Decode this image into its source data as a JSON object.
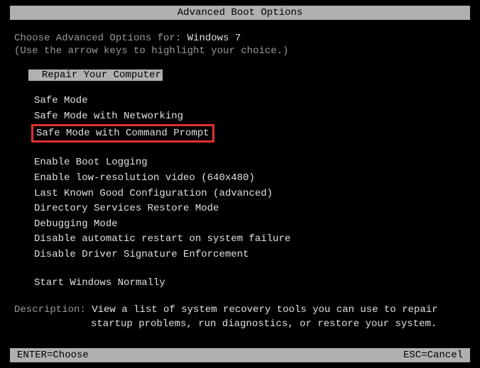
{
  "title": "Advanced Boot Options",
  "prompt": {
    "prefix": "Choose Advanced Options for: ",
    "os": "Windows 7"
  },
  "hint": "(Use the arrow keys to highlight your choice.)",
  "selected_option": "Repair Your Computer",
  "menu_group1": [
    "Safe Mode",
    "Safe Mode with Networking"
  ],
  "highlighted_item": "Safe Mode with Command Prompt",
  "menu_group2": [
    "Enable Boot Logging",
    "Enable low-resolution video (640x480)",
    "Last Known Good Configuration (advanced)",
    "Directory Services Restore Mode",
    "Debugging Mode",
    "Disable automatic restart on system failure",
    "Disable Driver Signature Enforcement"
  ],
  "menu_group3": [
    "Start Windows Normally"
  ],
  "description": {
    "label": "Description: ",
    "line1": "View a list of system recovery tools you can use to repair",
    "line2": "startup problems, run diagnostics, or restore your system."
  },
  "footer": {
    "left": "ENTER=Choose",
    "right": "ESC=Cancel"
  }
}
